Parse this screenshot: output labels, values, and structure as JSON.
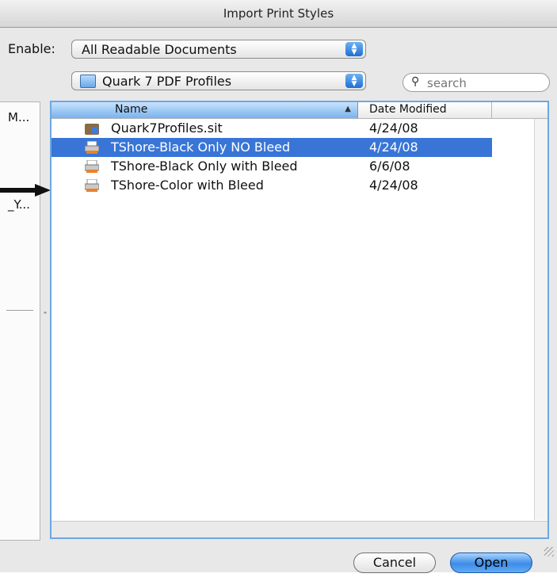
{
  "window": {
    "title": "Import Print Styles"
  },
  "enable": {
    "label": "Enable:",
    "selected": "All Readable Documents"
  },
  "location": {
    "selected": "Quark 7 PDF Profiles"
  },
  "search": {
    "placeholder": "search",
    "value": ""
  },
  "sidebar": {
    "labels": [
      "M...",
      "_Y..."
    ]
  },
  "columns": {
    "name": "Name",
    "date": "Date Modified"
  },
  "files": [
    {
      "name": "Quark7Profiles.sit",
      "date": "4/24/08",
      "selected": false,
      "icon": "archive-icon"
    },
    {
      "name": "TShore-Black Only NO Bleed",
      "date": "4/24/08",
      "selected": true,
      "icon": "profile-icon"
    },
    {
      "name": "TShore-Black Only with Bleed",
      "date": "6/6/08",
      "selected": false,
      "icon": "profile-icon"
    },
    {
      "name": "TShore-Color with Bleed",
      "date": "4/24/08",
      "selected": false,
      "icon": "profile-icon"
    }
  ],
  "buttons": {
    "cancel": "Cancel",
    "open": "Open"
  },
  "colors": {
    "selection": "#3875d7",
    "accent": "#3d8ce8",
    "frame": "#6ea7e3"
  }
}
